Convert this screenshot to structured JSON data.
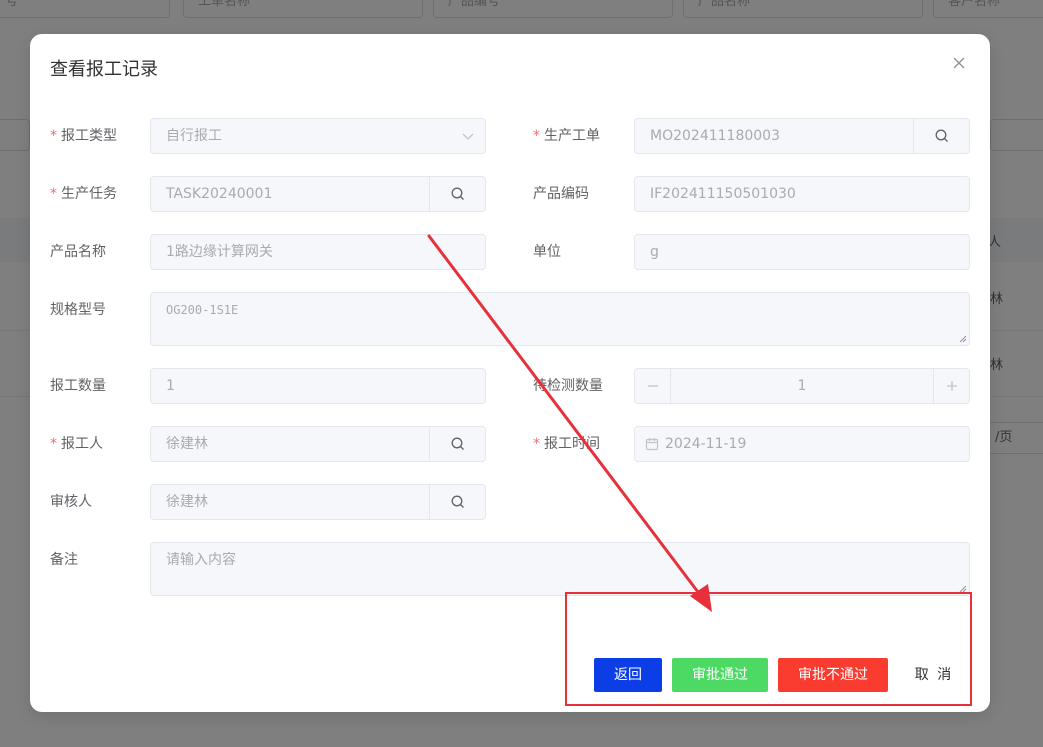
{
  "background": {
    "filters": [
      "号",
      "工单名称",
      "产品编号",
      "产品名称",
      "客户名称"
    ],
    "col_header_partial": "人",
    "cell_partial_1": "林",
    "cell_partial_2": "林",
    "page_size_partial": "/页"
  },
  "dialog": {
    "title": "查看报工记录",
    "fields": {
      "report_type": {
        "label": "报工类型",
        "value": "自行报工"
      },
      "work_order": {
        "label": "生产工单",
        "value": "MO202411180003"
      },
      "task": {
        "label": "生产任务",
        "value": "TASK20240001"
      },
      "product_code": {
        "label": "产品编码",
        "value": "IF202411150501030"
      },
      "product_name": {
        "label": "产品名称",
        "value": "1路边缘计算网关"
      },
      "unit": {
        "label": "单位",
        "value": "g"
      },
      "spec": {
        "label": "规格型号",
        "value": "OG200-1S1E"
      },
      "quantity": {
        "label": "报工数量",
        "value": "1"
      },
      "pending_qty": {
        "label": "待检测数量",
        "value": "1"
      },
      "reporter": {
        "label": "报工人",
        "value": "徐建林"
      },
      "report_time": {
        "label": "报工时间",
        "value": "2024-11-19"
      },
      "reviewer": {
        "label": "审核人",
        "value": "徐建林"
      },
      "remark": {
        "label": "备注",
        "placeholder": "请输入内容"
      }
    },
    "footer": {
      "back": "返回",
      "approve": "审批通过",
      "reject": "审批不通过",
      "cancel": "取 消"
    }
  },
  "colors": {
    "back_button": "#0b3ee6",
    "approve_button": "#4cd964",
    "reject_button": "#fa3b30",
    "required_mark": "#f56c6c",
    "annotation": "#e8303a"
  }
}
